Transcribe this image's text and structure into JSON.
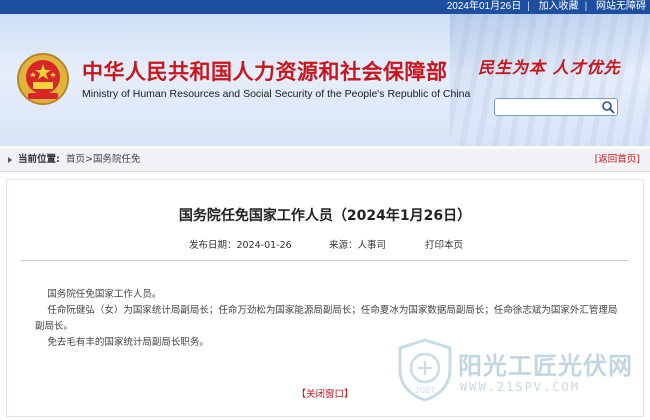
{
  "topbar": {
    "date": "2024年01月26日",
    "favorite": "加入收藏",
    "accessible": "网站无障碍"
  },
  "header": {
    "title_cn": "中华人民共和国人力资源和社会保障部",
    "title_en": "Ministry of Human Resources and Social Security of the People's Republic of China",
    "slogan": "民生为本 人才优先",
    "search_placeholder": ""
  },
  "breadcrumb": {
    "label": "当前位置:",
    "home": "首页",
    "separator": ">",
    "section": "国务院任免",
    "back": "[返回首页]"
  },
  "article": {
    "title": "国务院任免国家工作人员（2024年1月26日）",
    "date": "发布日期：2024-01-26",
    "source": "来源：人事司",
    "print": "打印本页",
    "paragraphs": [
      "国务院任免国家工作人员。",
      "任命阮健弘（女）为国家统计局副局长；任命万劲松为国家能源局副局长；任命夏冰为国家数据局副局长；任命徐志斌为国家外汇管理局副局长。",
      "免去毛有丰的国家统计局副局长职务。"
    ],
    "close": "【关闭窗口】"
  },
  "watermark": {
    "cn": "阳光工匠光伏网",
    "en": "WWW.21SPV.COM",
    "year": "2007"
  },
  "colors": {
    "brand_red": "#c8161d",
    "topbar_blue": "#1d4fa0"
  },
  "icons": {
    "emblem": "national-emblem-icon",
    "search": "search-icon",
    "breadcrumb": "triangle-right-icon"
  }
}
